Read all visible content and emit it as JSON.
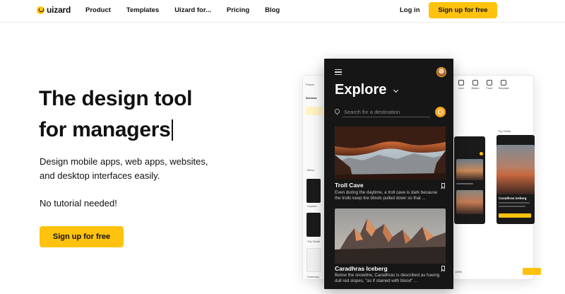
{
  "brand": {
    "name": "uizard",
    "accent": "#ffc20e"
  },
  "nav": {
    "links": [
      "Product",
      "Templates",
      "Uizard for...",
      "Pricing",
      "Blog"
    ],
    "login": "Log in",
    "signup": "Sign up for free"
  },
  "hero": {
    "title_line1": "The design tool",
    "title_line2": "for managers",
    "subtitle_line1": "Design mobile apps, web apps, websites,",
    "subtitle_line2": "and desktop interfaces easily.",
    "note": "No tutorial needed!",
    "cta": "Sign up for free"
  },
  "editor": {
    "tab_screens": "Screens",
    "panel_label": "Proper",
    "screen_labels": [
      "Menu",
      "Explore",
      "Trip Detail",
      "Summary"
    ],
    "tools": [
      "Icon",
      "Button",
      "Form",
      "Template"
    ],
    "trip_detail_label": "Trip Detail",
    "detail_title": "Caradhras Iceberg",
    "zoom": "100%",
    "icons": [
      "collapse-icon",
      "add-icon",
      "undo-icon",
      "redo-icon"
    ]
  },
  "phone": {
    "title": "Explore",
    "search_placeholder": "Search for a destination",
    "cards": [
      {
        "title": "Troll Cave",
        "description_line1": "Even during the daytime, a troll cave is dark because",
        "description_line2": "the trolls keep the blinds pulled down so that ..."
      },
      {
        "title": "Caradhras Iceberg",
        "description_line1": "Below the snowline, Caradhras is described as having",
        "description_line2": "dull red slopes, \"as if stained with blood\" ..."
      }
    ]
  }
}
